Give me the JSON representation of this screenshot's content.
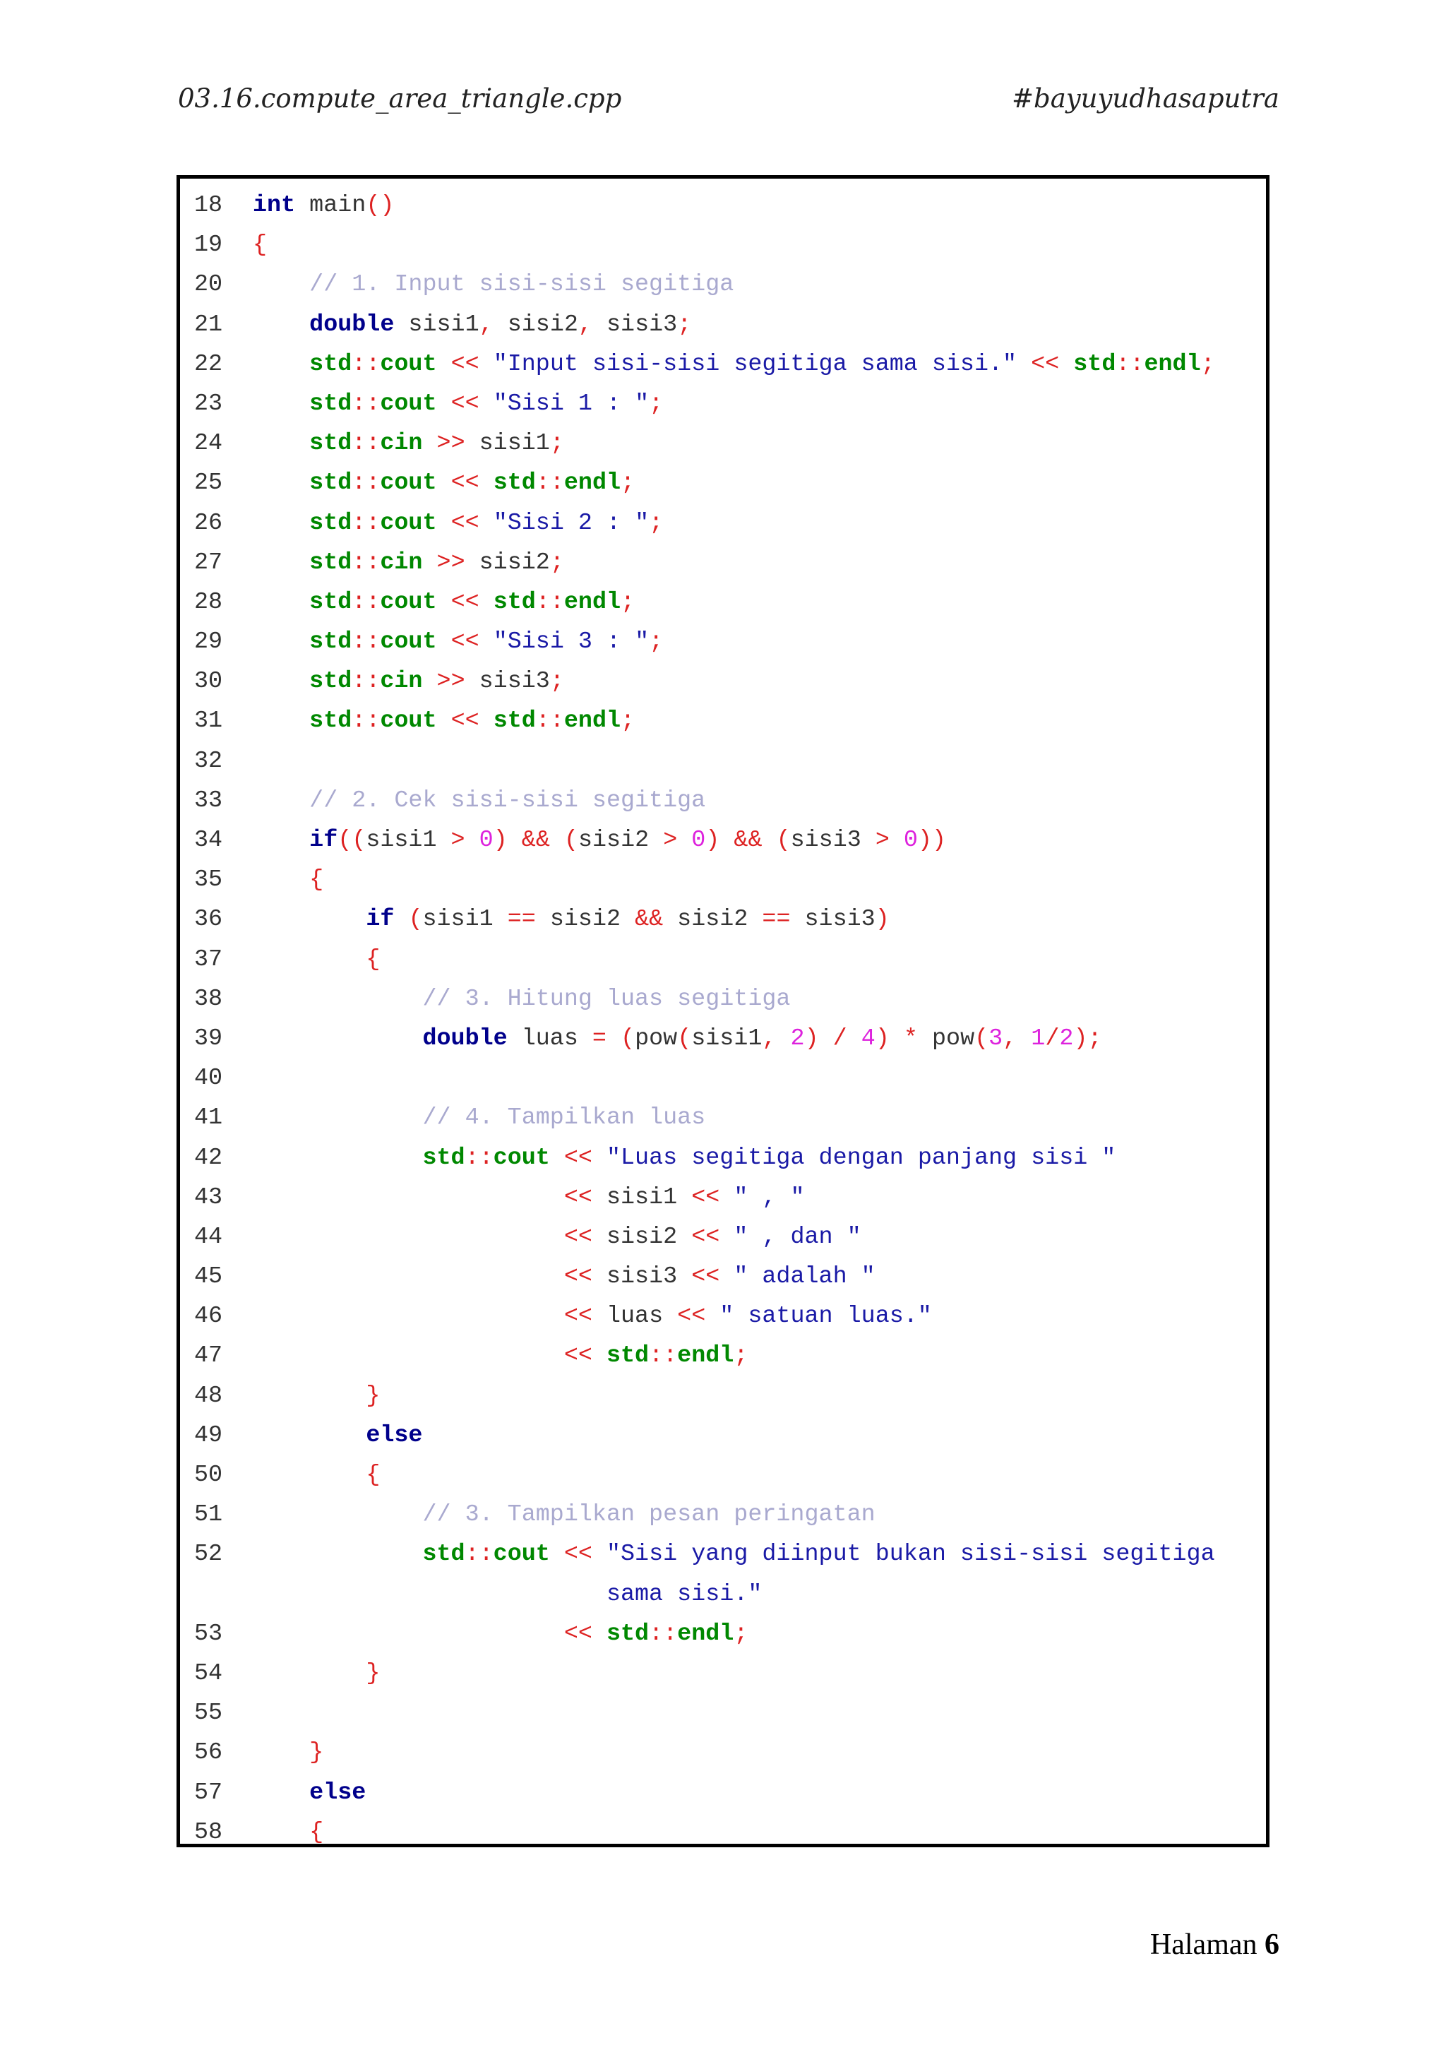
{
  "header": {
    "filename": "03.16.compute_area_triangle.cpp",
    "tag": "#bayuyudhasaputra"
  },
  "footer": {
    "label": "Halaman",
    "page": "6"
  },
  "code_lines": [
    {
      "n": "18",
      "tokens": [
        [
          "k",
          "int"
        ],
        [
          "p",
          " main"
        ],
        [
          "o",
          "()"
        ]
      ]
    },
    {
      "n": "19",
      "tokens": [
        [
          "o",
          "{"
        ]
      ]
    },
    {
      "n": "20",
      "tokens": [
        [
          "p",
          "    "
        ],
        [
          "c",
          "// 1. Input sisi-sisi segitiga"
        ]
      ]
    },
    {
      "n": "21",
      "tokens": [
        [
          "p",
          "    "
        ],
        [
          "k",
          "double"
        ],
        [
          "p",
          " sisi1"
        ],
        [
          "o",
          ","
        ],
        [
          "p",
          " sisi2"
        ],
        [
          "o",
          ","
        ],
        [
          "p",
          " sisi3"
        ],
        [
          "o",
          ";"
        ]
      ]
    },
    {
      "n": "22",
      "tokens": [
        [
          "p",
          "    "
        ],
        [
          "s",
          "std"
        ],
        [
          "o",
          "::"
        ],
        [
          "s",
          "cout"
        ],
        [
          "p",
          " "
        ],
        [
          "o",
          "<<"
        ],
        [
          "p",
          " "
        ],
        [
          "str",
          "\"Input sisi-sisi segitiga sama sisi.\""
        ],
        [
          "p",
          " "
        ],
        [
          "o",
          "<<"
        ],
        [
          "p",
          " "
        ],
        [
          "s",
          "std"
        ],
        [
          "o",
          "::"
        ],
        [
          "s",
          "endl"
        ],
        [
          "o",
          ";"
        ]
      ]
    },
    {
      "n": "23",
      "tokens": [
        [
          "p",
          "    "
        ],
        [
          "s",
          "std"
        ],
        [
          "o",
          "::"
        ],
        [
          "s",
          "cout"
        ],
        [
          "p",
          " "
        ],
        [
          "o",
          "<<"
        ],
        [
          "p",
          " "
        ],
        [
          "str",
          "\"Sisi 1 : \""
        ],
        [
          "o",
          ";"
        ]
      ]
    },
    {
      "n": "24",
      "tokens": [
        [
          "p",
          "    "
        ],
        [
          "s",
          "std"
        ],
        [
          "o",
          "::"
        ],
        [
          "s",
          "cin"
        ],
        [
          "p",
          " "
        ],
        [
          "o",
          ">>"
        ],
        [
          "p",
          " sisi1"
        ],
        [
          "o",
          ";"
        ]
      ]
    },
    {
      "n": "25",
      "tokens": [
        [
          "p",
          "    "
        ],
        [
          "s",
          "std"
        ],
        [
          "o",
          "::"
        ],
        [
          "s",
          "cout"
        ],
        [
          "p",
          " "
        ],
        [
          "o",
          "<<"
        ],
        [
          "p",
          " "
        ],
        [
          "s",
          "std"
        ],
        [
          "o",
          "::"
        ],
        [
          "s",
          "endl"
        ],
        [
          "o",
          ";"
        ]
      ]
    },
    {
      "n": "26",
      "tokens": [
        [
          "p",
          "    "
        ],
        [
          "s",
          "std"
        ],
        [
          "o",
          "::"
        ],
        [
          "s",
          "cout"
        ],
        [
          "p",
          " "
        ],
        [
          "o",
          "<<"
        ],
        [
          "p",
          " "
        ],
        [
          "str",
          "\"Sisi 2 : \""
        ],
        [
          "o",
          ";"
        ]
      ]
    },
    {
      "n": "27",
      "tokens": [
        [
          "p",
          "    "
        ],
        [
          "s",
          "std"
        ],
        [
          "o",
          "::"
        ],
        [
          "s",
          "cin"
        ],
        [
          "p",
          " "
        ],
        [
          "o",
          ">>"
        ],
        [
          "p",
          " sisi2"
        ],
        [
          "o",
          ";"
        ]
      ]
    },
    {
      "n": "28",
      "tokens": [
        [
          "p",
          "    "
        ],
        [
          "s",
          "std"
        ],
        [
          "o",
          "::"
        ],
        [
          "s",
          "cout"
        ],
        [
          "p",
          " "
        ],
        [
          "o",
          "<<"
        ],
        [
          "p",
          " "
        ],
        [
          "s",
          "std"
        ],
        [
          "o",
          "::"
        ],
        [
          "s",
          "endl"
        ],
        [
          "o",
          ";"
        ]
      ]
    },
    {
      "n": "29",
      "tokens": [
        [
          "p",
          "    "
        ],
        [
          "s",
          "std"
        ],
        [
          "o",
          "::"
        ],
        [
          "s",
          "cout"
        ],
        [
          "p",
          " "
        ],
        [
          "o",
          "<<"
        ],
        [
          "p",
          " "
        ],
        [
          "str",
          "\"Sisi 3 : \""
        ],
        [
          "o",
          ";"
        ]
      ]
    },
    {
      "n": "30",
      "tokens": [
        [
          "p",
          "    "
        ],
        [
          "s",
          "std"
        ],
        [
          "o",
          "::"
        ],
        [
          "s",
          "cin"
        ],
        [
          "p",
          " "
        ],
        [
          "o",
          ">>"
        ],
        [
          "p",
          " sisi3"
        ],
        [
          "o",
          ";"
        ]
      ]
    },
    {
      "n": "31",
      "tokens": [
        [
          "p",
          "    "
        ],
        [
          "s",
          "std"
        ],
        [
          "o",
          "::"
        ],
        [
          "s",
          "cout"
        ],
        [
          "p",
          " "
        ],
        [
          "o",
          "<<"
        ],
        [
          "p",
          " "
        ],
        [
          "s",
          "std"
        ],
        [
          "o",
          "::"
        ],
        [
          "s",
          "endl"
        ],
        [
          "o",
          ";"
        ]
      ]
    },
    {
      "n": "32",
      "tokens": []
    },
    {
      "n": "33",
      "tokens": [
        [
          "p",
          "    "
        ],
        [
          "c",
          "// 2. Cek sisi-sisi segitiga"
        ]
      ]
    },
    {
      "n": "34",
      "tokens": [
        [
          "p",
          "    "
        ],
        [
          "k",
          "if"
        ],
        [
          "o",
          "(("
        ],
        [
          "p",
          "sisi1 "
        ],
        [
          "o",
          ">"
        ],
        [
          "p",
          " "
        ],
        [
          "n",
          "0"
        ],
        [
          "o",
          ")"
        ],
        [
          "p",
          " "
        ],
        [
          "o",
          "&&"
        ],
        [
          "p",
          " "
        ],
        [
          "o",
          "("
        ],
        [
          "p",
          "sisi2 "
        ],
        [
          "o",
          ">"
        ],
        [
          "p",
          " "
        ],
        [
          "n",
          "0"
        ],
        [
          "o",
          ")"
        ],
        [
          "p",
          " "
        ],
        [
          "o",
          "&&"
        ],
        [
          "p",
          " "
        ],
        [
          "o",
          "("
        ],
        [
          "p",
          "sisi3 "
        ],
        [
          "o",
          ">"
        ],
        [
          "p",
          " "
        ],
        [
          "n",
          "0"
        ],
        [
          "o",
          "))"
        ]
      ]
    },
    {
      "n": "35",
      "tokens": [
        [
          "p",
          "    "
        ],
        [
          "o",
          "{"
        ]
      ]
    },
    {
      "n": "36",
      "tokens": [
        [
          "p",
          "        "
        ],
        [
          "k",
          "if"
        ],
        [
          "p",
          " "
        ],
        [
          "o",
          "("
        ],
        [
          "p",
          "sisi1 "
        ],
        [
          "o",
          "=="
        ],
        [
          "p",
          " sisi2 "
        ],
        [
          "o",
          "&&"
        ],
        [
          "p",
          " sisi2 "
        ],
        [
          "o",
          "=="
        ],
        [
          "p",
          " sisi3"
        ],
        [
          "o",
          ")"
        ]
      ]
    },
    {
      "n": "37",
      "tokens": [
        [
          "p",
          "        "
        ],
        [
          "o",
          "{"
        ]
      ]
    },
    {
      "n": "38",
      "tokens": [
        [
          "p",
          "            "
        ],
        [
          "c",
          "// 3. Hitung luas segitiga"
        ]
      ]
    },
    {
      "n": "39",
      "tokens": [
        [
          "p",
          "            "
        ],
        [
          "k",
          "double"
        ],
        [
          "p",
          " luas "
        ],
        [
          "o",
          "="
        ],
        [
          "p",
          " "
        ],
        [
          "o",
          "("
        ],
        [
          "p",
          "pow"
        ],
        [
          "o",
          "("
        ],
        [
          "p",
          "sisi1"
        ],
        [
          "o",
          ","
        ],
        [
          "p",
          " "
        ],
        [
          "n",
          "2"
        ],
        [
          "o",
          ")"
        ],
        [
          "p",
          " "
        ],
        [
          "o",
          "/"
        ],
        [
          "p",
          " "
        ],
        [
          "n",
          "4"
        ],
        [
          "o",
          ")"
        ],
        [
          "p",
          " "
        ],
        [
          "o",
          "*"
        ],
        [
          "p",
          " pow"
        ],
        [
          "o",
          "("
        ],
        [
          "n",
          "3"
        ],
        [
          "o",
          ","
        ],
        [
          "p",
          " "
        ],
        [
          "n",
          "1"
        ],
        [
          "o",
          "/"
        ],
        [
          "n",
          "2"
        ],
        [
          "o",
          ");"
        ]
      ]
    },
    {
      "n": "40",
      "tokens": []
    },
    {
      "n": "41",
      "tokens": [
        [
          "p",
          "            "
        ],
        [
          "c",
          "// 4. Tampilkan luas"
        ]
      ]
    },
    {
      "n": "42",
      "tokens": [
        [
          "p",
          "            "
        ],
        [
          "s",
          "std"
        ],
        [
          "o",
          "::"
        ],
        [
          "s",
          "cout"
        ],
        [
          "p",
          " "
        ],
        [
          "o",
          "<<"
        ],
        [
          "p",
          " "
        ],
        [
          "str",
          "\"Luas segitiga dengan panjang sisi \""
        ]
      ]
    },
    {
      "n": "43",
      "tokens": [
        [
          "p",
          "                      "
        ],
        [
          "o",
          "<<"
        ],
        [
          "p",
          " sisi1 "
        ],
        [
          "o",
          "<<"
        ],
        [
          "p",
          " "
        ],
        [
          "str",
          "\" , \""
        ]
      ]
    },
    {
      "n": "44",
      "tokens": [
        [
          "p",
          "                      "
        ],
        [
          "o",
          "<<"
        ],
        [
          "p",
          " sisi2 "
        ],
        [
          "o",
          "<<"
        ],
        [
          "p",
          " "
        ],
        [
          "str",
          "\" , dan \""
        ]
      ]
    },
    {
      "n": "45",
      "tokens": [
        [
          "p",
          "                      "
        ],
        [
          "o",
          "<<"
        ],
        [
          "p",
          " sisi3 "
        ],
        [
          "o",
          "<<"
        ],
        [
          "p",
          " "
        ],
        [
          "str",
          "\" adalah \""
        ]
      ]
    },
    {
      "n": "46",
      "tokens": [
        [
          "p",
          "                      "
        ],
        [
          "o",
          "<<"
        ],
        [
          "p",
          " luas "
        ],
        [
          "o",
          "<<"
        ],
        [
          "p",
          " "
        ],
        [
          "str",
          "\" satuan luas.\""
        ]
      ]
    },
    {
      "n": "47",
      "tokens": [
        [
          "p",
          "                      "
        ],
        [
          "o",
          "<<"
        ],
        [
          "p",
          " "
        ],
        [
          "s",
          "std"
        ],
        [
          "o",
          "::"
        ],
        [
          "s",
          "endl"
        ],
        [
          "o",
          ";"
        ]
      ]
    },
    {
      "n": "48",
      "tokens": [
        [
          "p",
          "        "
        ],
        [
          "o",
          "}"
        ]
      ]
    },
    {
      "n": "49",
      "tokens": [
        [
          "p",
          "        "
        ],
        [
          "k",
          "else"
        ]
      ]
    },
    {
      "n": "50",
      "tokens": [
        [
          "p",
          "        "
        ],
        [
          "o",
          "{"
        ]
      ]
    },
    {
      "n": "51",
      "tokens": [
        [
          "p",
          "            "
        ],
        [
          "c",
          "// 3. Tampilkan pesan peringatan"
        ]
      ]
    },
    {
      "n": "52",
      "tokens": [
        [
          "p",
          "            "
        ],
        [
          "s",
          "std"
        ],
        [
          "o",
          "::"
        ],
        [
          "s",
          "cout"
        ],
        [
          "p",
          " "
        ],
        [
          "o",
          "<<"
        ],
        [
          "p",
          " "
        ],
        [
          "str",
          "\"Sisi yang diinput bukan sisi-sisi segitiga\n                         sama sisi.\""
        ]
      ]
    },
    {
      "n": "53",
      "tokens": [
        [
          "p",
          "                      "
        ],
        [
          "o",
          "<<"
        ],
        [
          "p",
          " "
        ],
        [
          "s",
          "std"
        ],
        [
          "o",
          "::"
        ],
        [
          "s",
          "endl"
        ],
        [
          "o",
          ";"
        ]
      ]
    },
    {
      "n": "54",
      "tokens": [
        [
          "p",
          "        "
        ],
        [
          "o",
          "}"
        ]
      ]
    },
    {
      "n": "55",
      "tokens": []
    },
    {
      "n": "56",
      "tokens": [
        [
          "p",
          "    "
        ],
        [
          "o",
          "}"
        ]
      ]
    },
    {
      "n": "57",
      "tokens": [
        [
          "p",
          "    "
        ],
        [
          "k",
          "else"
        ]
      ]
    },
    {
      "n": "58",
      "tokens": [
        [
          "p",
          "    "
        ],
        [
          "o",
          "{"
        ]
      ]
    }
  ]
}
